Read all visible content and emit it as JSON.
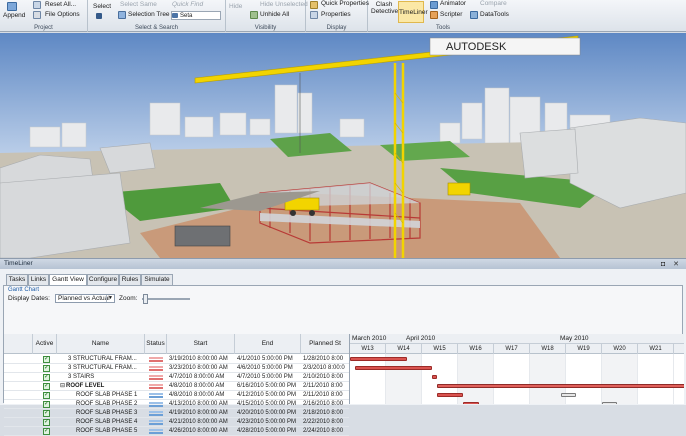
{
  "ribbon": {
    "append_label": "Append",
    "reset_all_label": "Reset All...",
    "file_options_label": "File Options",
    "project_caption": "Project",
    "select_label": "Select",
    "select_same_label": "Select Same",
    "selection_tree_label": "Selection Tree",
    "quick_find_label": "Quick Find",
    "search_value": "Seta",
    "select_search_caption": "Select & Search",
    "hide_label": "Hide",
    "hide_unselected_label": "Hide Unselected",
    "unhide_all_label": "Unhide All",
    "visibility_caption": "Visibility",
    "quick_properties_label": "Quick Properties",
    "properties_label": "Properties",
    "display_caption": "Display",
    "clash_detective_label": "Clash Detective",
    "timeliner_label": "TimeLiner",
    "animator_label": "Animator",
    "compare_label": "Compare",
    "scripter_label": "Scripter",
    "datatools_label": "DataTools",
    "tools_caption": "Tools",
    "colors": {
      "accent": "#fbe8a6"
    }
  },
  "scene": {
    "crane_sign": "AUTODESK"
  },
  "timeliner": {
    "title": "TimeLiner",
    "tabs": [
      "Tasks",
      "Links",
      "Gantt View",
      "Configure",
      "Rules",
      "Simulate"
    ],
    "active_tab": "Gantt View",
    "gantt_chart_label": "Gantt Chart",
    "display_dates_label": "Display Dates:",
    "display_dates_value": "Planned vs Actual",
    "zoom_label": "Zoom:",
    "columns": [
      "Active",
      "Name",
      "Status",
      "Start",
      "End",
      "Planned St"
    ],
    "rows": [
      {
        "name": "3 STRUCTURAL FRAM...",
        "start": "3/19/2010 8:00:00 AM",
        "end": "4/1/2010 5:00:00 PM",
        "planned": "1/28/2010 8:00"
      },
      {
        "name": "3 STRUCTURAL FRAM...",
        "start": "3/23/2010 8:00:00 AM",
        "end": "4/6/2010 5:00:00 PM",
        "planned": "2/3/2010 8:00:0"
      },
      {
        "name": "3 STAIRS",
        "start": "4/7/2010 8:00:00 AM",
        "end": "4/7/2010 5:00:00 PM",
        "planned": "2/10/2010 8:00"
      },
      {
        "name": "ROOF LEVEL",
        "start": "4/8/2010 8:00:00 AM",
        "end": "6/16/2010 5:00:00 PM",
        "planned": "2/11/2010 8:00"
      },
      {
        "name": "ROOF SLAB PHASE 1",
        "start": "4/8/2010 8:00:00 AM",
        "end": "4/12/2010 5:00:00 PM",
        "planned": "2/11/2010 8:00"
      },
      {
        "name": "ROOF SLAB PHASE 2",
        "start": "4/13/2010 8:00:00 AM",
        "end": "4/15/2010 5:00:00 PM",
        "planned": "2/16/2010 8:00"
      },
      {
        "name": "ROOF SLAB PHASE 3",
        "start": "4/19/2010 8:00:00 AM",
        "end": "4/20/2010 5:00:00 PM",
        "planned": "2/18/2010 8:00"
      },
      {
        "name": "ROOF SLAB PHASE 4",
        "start": "4/21/2010 8:00:00 AM",
        "end": "4/23/2010 5:00:00 PM",
        "planned": "2/22/2010 8:00"
      },
      {
        "name": "ROOF SLAB PHASE 5",
        "start": "4/26/2010 8:00:00 AM",
        "end": "4/28/2010 5:00:00 PM",
        "planned": "2/24/2010 8:00"
      }
    ],
    "months": [
      "March 2010",
      "April 2010",
      "May 2010"
    ],
    "weeks": [
      "W13",
      "W14",
      "W15",
      "W16",
      "W17",
      "W18",
      "W19",
      "W20",
      "W21"
    ]
  }
}
